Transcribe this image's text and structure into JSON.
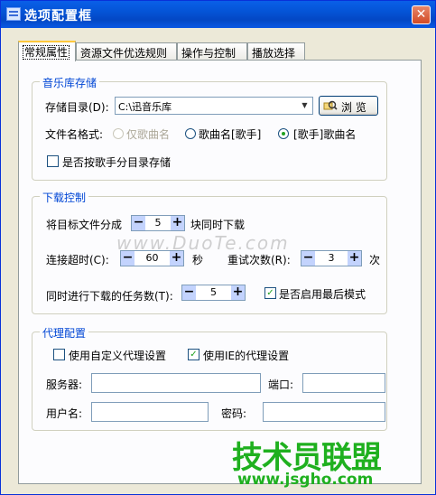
{
  "window": {
    "title": "选项配置框",
    "close_label": "✕"
  },
  "tabs": [
    {
      "label": "常规属性"
    },
    {
      "label": "资源文件优选规则"
    },
    {
      "label": "操作与控制"
    },
    {
      "label": "播放选择"
    }
  ],
  "library": {
    "group_title": "音乐库存储",
    "dir_label": "存储目录(D):",
    "dir_value": "C:\\迅音乐库",
    "browse_label": "浏 览",
    "format_label": "文件名格式:",
    "format_options": [
      "仅歌曲名",
      "歌曲名[歌手]",
      "[歌手]歌曲名"
    ],
    "format_selected": 2,
    "by_artist_label": "是否按歌手分目录存储",
    "by_artist_checked": false
  },
  "download": {
    "group_title": "下载控制",
    "split_prefix": "将目标文件分成",
    "split_value": "5",
    "split_suffix": "块同时下载",
    "timeout_label": "连接超时(C):",
    "timeout_value": "60",
    "timeout_unit": "秒",
    "retry_label": "重试次数(R):",
    "retry_value": "3",
    "retry_unit": "次",
    "tasks_label": "同时进行下载的任务数(T):",
    "tasks_value": "5",
    "fast_mode_label": "是否启用最后模式",
    "fast_mode_checked": true
  },
  "proxy": {
    "group_title": "代理配置",
    "custom_label": "使用自定义代理设置",
    "custom_checked": false,
    "ie_label": "使用IE的代理设置",
    "ie_checked": true,
    "server_label": "服务器:",
    "server_value": "",
    "port_label": "端口:",
    "port_value": "",
    "user_label": "用户名:",
    "user_value": "",
    "password_label": "密码:",
    "password_value": ""
  },
  "spinner": {
    "minus": "−",
    "plus": "+"
  },
  "icons": {
    "browse": "search-folder-icon",
    "combo_arrow": "▼",
    "check_mark": "✓"
  },
  "watermarks": {
    "duote": "www.DuoTe.com",
    "logo_green": "技术员联盟",
    "logo_url": "www.jsgho.com"
  }
}
